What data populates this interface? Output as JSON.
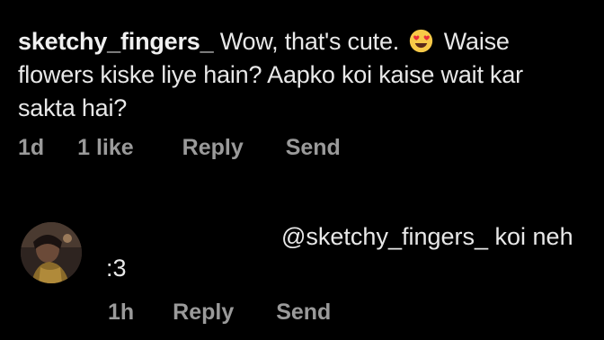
{
  "comment": {
    "username": "sketchy_fingers_",
    "text_line1_a": "Wow, that's cute.",
    "emoji": "heart-eyes-emoji",
    "text_line1_b": "Waise",
    "text_line2": "flowers kiske liye hain? Aapko koi kaise wait kar",
    "text_line3": "sakta hai?",
    "time": "1d",
    "likes": "1 like",
    "reply_label": "Reply",
    "send_label": "Send"
  },
  "reply": {
    "avatar": "avatar",
    "text_line1": "@sketchy_fingers_ koi neh",
    "text_line2": ":3",
    "time": "1h",
    "reply_label": "Reply",
    "send_label": "Send"
  },
  "colors": {
    "background": "#000000",
    "text": "#e8e8e8",
    "meta": "#9a9a9a"
  }
}
